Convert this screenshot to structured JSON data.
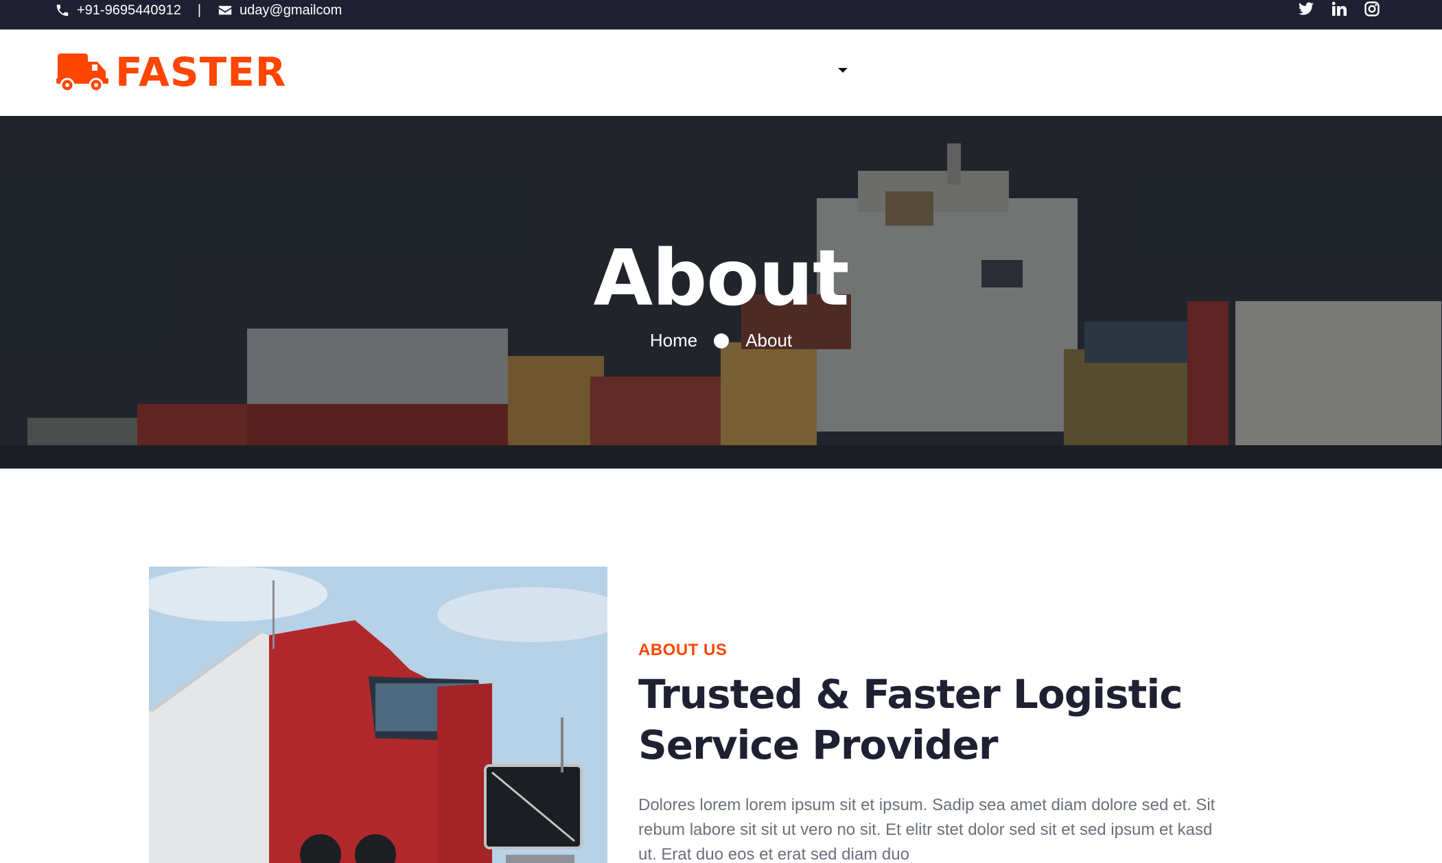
{
  "topbar": {
    "phone": "+91-9695440912",
    "separator": "|",
    "email": "uday@gmailcom",
    "icons": [
      "phone-icon",
      "envelope-icon",
      "twitter-icon",
      "linkedin-icon",
      "instagram-icon"
    ]
  },
  "navbar": {
    "brand": "FASTER",
    "brand_color": "#ff4500",
    "icons": [
      "truck-logo-icon",
      "dropdown-caret-icon"
    ]
  },
  "hero": {
    "title": "About",
    "breadcrumb": [
      "Home",
      "About"
    ]
  },
  "about": {
    "eyebrow": "ABOUT US",
    "heading_line1": "Trusted & Faster Logistic",
    "heading_line2": "Service Provider",
    "paragraph_line1": "Dolores lorem lorem ipsum sit et ipsum. Sadip sea amet diam dolore sed et. Sit",
    "paragraph_line2": "rebum labore sit sit ut vero no sit. Et elitr stet dolor sed sit et sed ipsum et kasd",
    "paragraph_line3": "ut. Erat duo eos et erat sed diam duo"
  },
  "colors": {
    "accent": "#ff4500",
    "dark": "#1f2032",
    "text_muted": "#6b6f7b"
  }
}
